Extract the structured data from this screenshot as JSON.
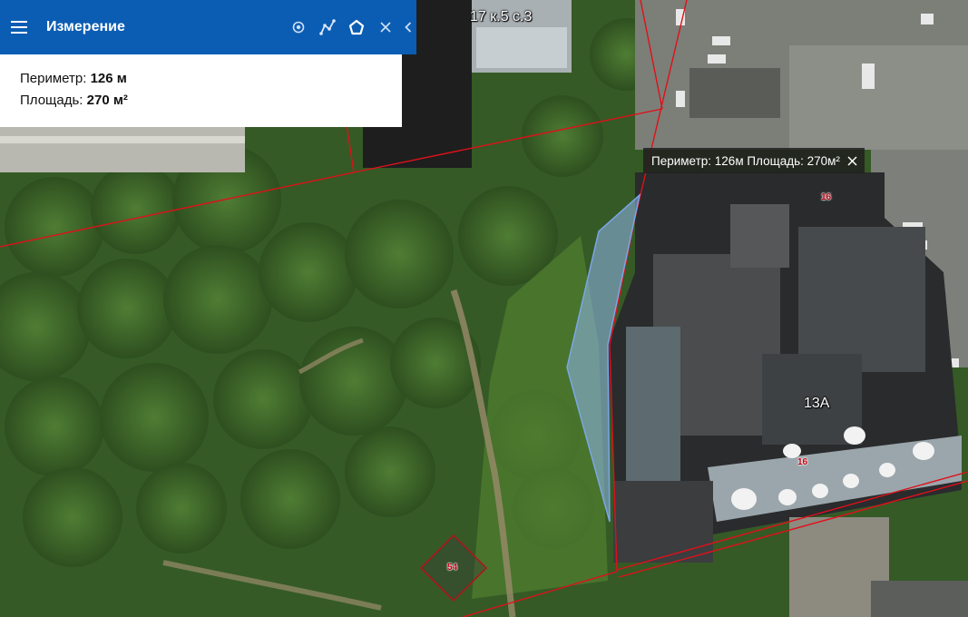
{
  "toolbar": {
    "title": "Измерение",
    "menu_icon": "menu-icon",
    "tools": [
      "point-icon",
      "polyline-icon",
      "polygon-icon",
      "close-icon",
      "collapse-chevron-icon"
    ]
  },
  "measurement": {
    "perimeter_label": "Периметр:",
    "perimeter_value": "126 м",
    "area_label": "Площадь:",
    "area_value": "270 м²"
  },
  "tooltip": {
    "text": "Периметр: 126м Площадь: 270м²"
  },
  "map_labels": {
    "building_top": "17 к.5 с.3",
    "building_main": "13А",
    "parcel_a": "16",
    "parcel_b": "16",
    "parcel_c": "54"
  },
  "colors": {
    "toolbar": "#0b5db3",
    "boundary": "#e0101a",
    "measured_polygon": "#8fb6ee"
  }
}
